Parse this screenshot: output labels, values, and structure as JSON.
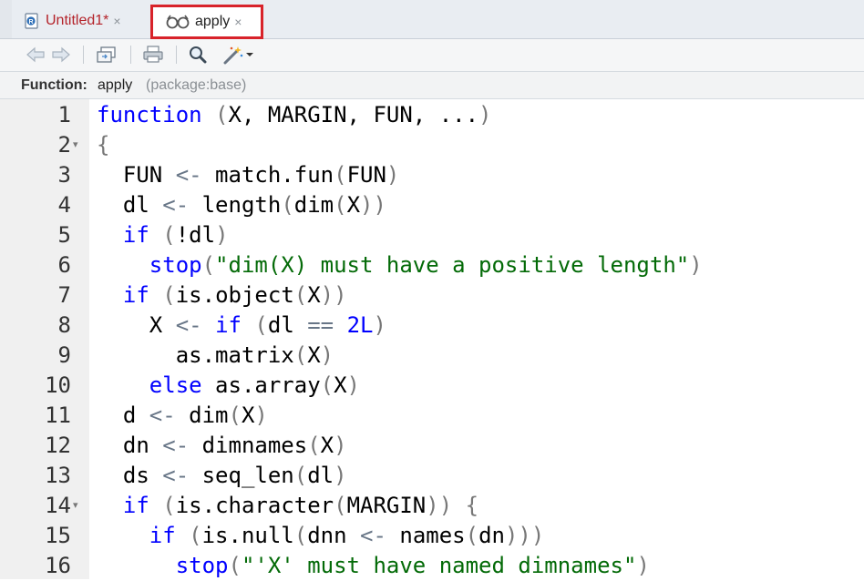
{
  "tabs": [
    {
      "label": "Untitled1*",
      "close": "×"
    },
    {
      "label": "apply",
      "close": "×"
    }
  ],
  "function_bar": {
    "label": "Function:",
    "name": "apply",
    "package": "(package:base)"
  },
  "colors": {
    "keyword": "#0000ff",
    "string": "#036a07",
    "highlight_box": "#d8232a",
    "untitled_tab": "#b4232a"
  },
  "toolbar_icons": [
    "back-arrow-icon",
    "forward-arrow-icon",
    "show-in-window-icon",
    "print-icon",
    "find-icon",
    "code-tools-wand-icon",
    "dropdown-caret-icon"
  ],
  "lines": [
    {
      "n": "1",
      "fold": false,
      "tokens": [
        [
          "keyword",
          "function"
        ],
        [
          "normal",
          " "
        ],
        [
          "paren",
          "("
        ],
        [
          "normal",
          "X, MARGIN, FUN, ..."
        ],
        [
          "paren",
          ")"
        ]
      ]
    },
    {
      "n": "2",
      "fold": true,
      "tokens": [
        [
          "paren",
          "{"
        ]
      ]
    },
    {
      "n": "3",
      "fold": false,
      "tokens": [
        [
          "normal",
          "  FUN "
        ],
        [
          "op",
          "<-"
        ],
        [
          "normal",
          " match.fun"
        ],
        [
          "paren",
          "("
        ],
        [
          "normal",
          "FUN"
        ],
        [
          "paren",
          ")"
        ]
      ]
    },
    {
      "n": "4",
      "fold": false,
      "tokens": [
        [
          "normal",
          "  dl "
        ],
        [
          "op",
          "<-"
        ],
        [
          "normal",
          " length"
        ],
        [
          "paren",
          "("
        ],
        [
          "normal",
          "dim"
        ],
        [
          "paren",
          "("
        ],
        [
          "normal",
          "X"
        ],
        [
          "paren",
          "))"
        ]
      ]
    },
    {
      "n": "5",
      "fold": false,
      "tokens": [
        [
          "normal",
          "  "
        ],
        [
          "keyword",
          "if"
        ],
        [
          "normal",
          " "
        ],
        [
          "paren",
          "("
        ],
        [
          "normal",
          "!dl"
        ],
        [
          "paren",
          ")"
        ]
      ]
    },
    {
      "n": "6",
      "fold": false,
      "tokens": [
        [
          "normal",
          "    "
        ],
        [
          "keyword",
          "stop"
        ],
        [
          "paren",
          "("
        ],
        [
          "string",
          "\"dim(X) must have a positive length\""
        ],
        [
          "paren",
          ")"
        ]
      ]
    },
    {
      "n": "7",
      "fold": false,
      "tokens": [
        [
          "normal",
          "  "
        ],
        [
          "keyword",
          "if"
        ],
        [
          "normal",
          " "
        ],
        [
          "paren",
          "("
        ],
        [
          "normal",
          "is.object"
        ],
        [
          "paren",
          "("
        ],
        [
          "normal",
          "X"
        ],
        [
          "paren",
          "))"
        ]
      ]
    },
    {
      "n": "8",
      "fold": false,
      "tokens": [
        [
          "normal",
          "    X "
        ],
        [
          "op",
          "<-"
        ],
        [
          "normal",
          " "
        ],
        [
          "keyword",
          "if"
        ],
        [
          "normal",
          " "
        ],
        [
          "paren",
          "("
        ],
        [
          "normal",
          "dl "
        ],
        [
          "op",
          "=="
        ],
        [
          "normal",
          " "
        ],
        [
          "number",
          "2L"
        ],
        [
          "paren",
          ")"
        ]
      ]
    },
    {
      "n": "9",
      "fold": false,
      "tokens": [
        [
          "normal",
          "      as.matrix"
        ],
        [
          "paren",
          "("
        ],
        [
          "normal",
          "X"
        ],
        [
          "paren",
          ")"
        ]
      ]
    },
    {
      "n": "10",
      "fold": false,
      "tokens": [
        [
          "normal",
          "    "
        ],
        [
          "keyword",
          "else"
        ],
        [
          "normal",
          " as.array"
        ],
        [
          "paren",
          "("
        ],
        [
          "normal",
          "X"
        ],
        [
          "paren",
          ")"
        ]
      ]
    },
    {
      "n": "11",
      "fold": false,
      "tokens": [
        [
          "normal",
          "  d "
        ],
        [
          "op",
          "<-"
        ],
        [
          "normal",
          " dim"
        ],
        [
          "paren",
          "("
        ],
        [
          "normal",
          "X"
        ],
        [
          "paren",
          ")"
        ]
      ]
    },
    {
      "n": "12",
      "fold": false,
      "tokens": [
        [
          "normal",
          "  dn "
        ],
        [
          "op",
          "<-"
        ],
        [
          "normal",
          " dimnames"
        ],
        [
          "paren",
          "("
        ],
        [
          "normal",
          "X"
        ],
        [
          "paren",
          ")"
        ]
      ]
    },
    {
      "n": "13",
      "fold": false,
      "tokens": [
        [
          "normal",
          "  ds "
        ],
        [
          "op",
          "<-"
        ],
        [
          "normal",
          " seq_len"
        ],
        [
          "paren",
          "("
        ],
        [
          "normal",
          "dl"
        ],
        [
          "paren",
          ")"
        ]
      ]
    },
    {
      "n": "14",
      "fold": true,
      "tokens": [
        [
          "normal",
          "  "
        ],
        [
          "keyword",
          "if"
        ],
        [
          "normal",
          " "
        ],
        [
          "paren",
          "("
        ],
        [
          "normal",
          "is.character"
        ],
        [
          "paren",
          "("
        ],
        [
          "normal",
          "MARGIN"
        ],
        [
          "paren",
          "))"
        ],
        [
          "normal",
          " "
        ],
        [
          "paren",
          "{"
        ]
      ]
    },
    {
      "n": "15",
      "fold": false,
      "tokens": [
        [
          "normal",
          "    "
        ],
        [
          "keyword",
          "if"
        ],
        [
          "normal",
          " "
        ],
        [
          "paren",
          "("
        ],
        [
          "normal",
          "is.null"
        ],
        [
          "paren",
          "("
        ],
        [
          "normal",
          "dnn "
        ],
        [
          "op",
          "<-"
        ],
        [
          "normal",
          " names"
        ],
        [
          "paren",
          "("
        ],
        [
          "normal",
          "dn"
        ],
        [
          "paren",
          ")))"
        ]
      ]
    },
    {
      "n": "16",
      "fold": false,
      "tokens": [
        [
          "normal",
          "      "
        ],
        [
          "keyword",
          "stop"
        ],
        [
          "paren",
          "("
        ],
        [
          "string",
          "\"'X' must have named dimnames\""
        ],
        [
          "paren",
          ")"
        ]
      ]
    }
  ]
}
